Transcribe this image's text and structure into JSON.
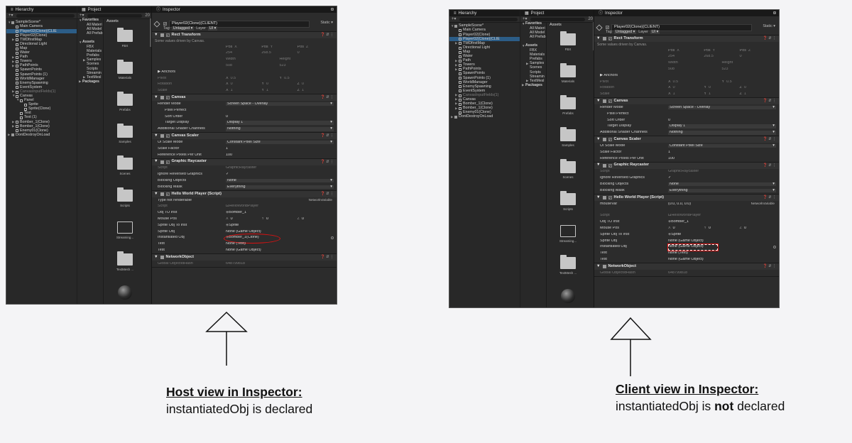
{
  "host": {
    "hierarchy": {
      "tab": "Hierarchy",
      "search": "All",
      "items": [
        {
          "label": "SampleScene*",
          "indent": 0,
          "arrow": "down",
          "kind": "scene"
        },
        {
          "label": "Main Camera",
          "indent": 1
        },
        {
          "label": "Player02(Clone)(CLIE",
          "indent": 1,
          "selected": true
        },
        {
          "label": "Player02(Clone)",
          "indent": 1
        },
        {
          "label": "TWDfirstMap",
          "indent": 1,
          "arrow": "right"
        },
        {
          "label": "Directional Light",
          "indent": 1
        },
        {
          "label": "Map",
          "indent": 1
        },
        {
          "label": "Water",
          "indent": 1
        },
        {
          "label": "Path",
          "indent": 1,
          "arrow": "right"
        },
        {
          "label": "Towers",
          "indent": 1,
          "arrow": "right"
        },
        {
          "label": "PathPoints",
          "indent": 1,
          "arrow": "right"
        },
        {
          "label": "SpawnPoints",
          "indent": 1
        },
        {
          "label": "SpawnPoints (1)",
          "indent": 1
        },
        {
          "label": "WorldManager",
          "indent": 1
        },
        {
          "label": "EnemySpawning",
          "indent": 1
        },
        {
          "label": "EventSystem",
          "indent": 1
        },
        {
          "label": "CanvasInputFields(1)",
          "indent": 1,
          "arrow": "right",
          "dim": true
        },
        {
          "label": "Canvas",
          "indent": 1,
          "arrow": "down"
        },
        {
          "label": "Panel",
          "indent": 2,
          "arrow": "down"
        },
        {
          "label": "Sprite",
          "indent": 3
        },
        {
          "label": "Sprite(Clone)",
          "indent": 3
        },
        {
          "label": "Text",
          "indent": 2
        },
        {
          "label": "Text (1)",
          "indent": 2
        },
        {
          "label": "Bomber_1(Clone)",
          "indent": 1,
          "arrow": "right"
        },
        {
          "label": "Bomber_1(Clone)",
          "indent": 1,
          "arrow": "right"
        },
        {
          "label": "Enemy01(Clone)",
          "indent": 1
        },
        {
          "label": "DontDestroyOnLoad",
          "indent": 0,
          "arrow": "right",
          "kind": "scene"
        }
      ]
    },
    "project": {
      "tab": "Project",
      "count": "20",
      "favorites": [
        {
          "label": "Favorites",
          "arrow": "down",
          "bold": true
        },
        {
          "label": "All Materi",
          "indent": 1
        },
        {
          "label": "All Model",
          "indent": 1
        },
        {
          "label": "All Prefab",
          "indent": 1
        },
        {
          "label": "",
          "spacer": true
        },
        {
          "label": "Assets",
          "arrow": "down",
          "bold": true
        },
        {
          "label": "FBX",
          "indent": 1
        },
        {
          "label": "Materials",
          "indent": 1
        },
        {
          "label": "Prefabs",
          "indent": 1
        },
        {
          "label": "Samples",
          "indent": 1,
          "arrow": "right"
        },
        {
          "label": "Scenes",
          "indent": 1
        },
        {
          "label": "Scripts",
          "indent": 1
        },
        {
          "label": "Streamin",
          "indent": 1
        },
        {
          "label": "TextMesl",
          "indent": 1,
          "arrow": "right"
        },
        {
          "label": "Packages",
          "arrow": "right",
          "bold": true
        }
      ],
      "assets_label": "Assets",
      "grid": [
        {
          "label": "FBX",
          "kind": "folder"
        },
        {
          "label": "Materials",
          "kind": "folder"
        },
        {
          "label": "Prefabs",
          "kind": "folder"
        },
        {
          "label": "Samples",
          "kind": "folder"
        },
        {
          "label": "Scenes",
          "kind": "folder"
        },
        {
          "label": "Scripts",
          "kind": "folder"
        },
        {
          "label": "Streaming...",
          "kind": "open"
        },
        {
          "label": "TextMesh ...",
          "kind": "folder"
        },
        {
          "label": "",
          "kind": "sphere"
        }
      ]
    },
    "inspector": {
      "tab": "Inspector",
      "object_name": "Player02(Clone)(CLIENT)",
      "static": "Static",
      "tag_label": "Tag",
      "tag": "Untagged",
      "layer_label": "Layer",
      "layer": "UI",
      "rect": {
        "title": "Rect Transform",
        "note": "Some values driven by Canvas.",
        "pos_labels": [
          "Pos X",
          "Pos Y",
          "Pos Z"
        ],
        "pos_values": [
          "254",
          "268.5",
          "0"
        ],
        "size_labels": [
          "Width",
          "Height"
        ],
        "size_values": [
          "508",
          "523"
        ],
        "anchors": "Anchors",
        "pivot_label": "Pivot",
        "pivot": [
          "X 0.5",
          "Y 0.5"
        ],
        "rotation_label": "Rotation",
        "rotation": [
          "X 0",
          "Y 0",
          "Z 0"
        ],
        "scale_label": "Scale",
        "scale": [
          "X 1",
          "Y 1",
          "Z 1"
        ]
      },
      "canvas": {
        "title": "Canvas",
        "rows": [
          [
            "Render Mode",
            "Screen Space - Overlay"
          ],
          [
            "Pixel Perfect",
            ""
          ],
          [
            "Sort Order",
            "0"
          ],
          [
            "Target Display",
            "Display 1"
          ],
          [
            "Additional Shader Channels",
            "Nothing"
          ]
        ]
      },
      "scaler": {
        "title": "Canvas Scaler",
        "rows": [
          [
            "UI Scale Mode",
            "Constant Pixel Size"
          ],
          [
            "Scale Factor",
            "1"
          ],
          [
            "Reference Pixels Per Unit",
            "100"
          ]
        ]
      },
      "raycaster": {
        "title": "Graphic Raycaster",
        "rows": [
          [
            "Script",
            "GraphicRaycaster"
          ],
          [
            "Ignore Reversed Graphics",
            "✓"
          ],
          [
            "Blocking Objects",
            "None"
          ],
          [
            "Blocking Mask",
            "Everything"
          ]
        ]
      },
      "hello": {
        "title": "Hello World Player (Script)",
        "extra_label": "Type not renderable",
        "extra_value": "NetworkVariable",
        "script_label": "Script",
        "script": "HelloWorldPlayer",
        "obj_to_inst_label": "Obj TO Inst",
        "obj_to_inst": "Bomber_1",
        "mouse_label": "Mouse Pos",
        "mouse": [
          "X 0",
          "Y 0",
          "Z 0"
        ],
        "sprite_to_inst_label": "Sprite Obj To Inst",
        "sprite_to_inst": "Sprite",
        "sprite_obj_label": "Sprite Obj",
        "sprite_obj": "None (Game Object)",
        "inst_label": "Instantiated Obj",
        "inst": "Bomber_1(Clone)",
        "text_label": "Text",
        "text": "None (Text)",
        "test_label": "Test",
        "test": "None (Game Object)"
      },
      "network": {
        "title": "NetworkObject",
        "row_label": "Global ObjectIdHash",
        "row_value": "648799818"
      }
    }
  },
  "client": {
    "hierarchy": {
      "items": [
        {
          "label": "SampleScene*",
          "indent": 0,
          "arrow": "down",
          "kind": "scene"
        },
        {
          "label": "Main Camera",
          "indent": 1
        },
        {
          "label": "Player02(Clone)",
          "indent": 1
        },
        {
          "label": "Player02(Clone)(CLIE",
          "indent": 1,
          "selected": true
        },
        {
          "label": "TWDfirstMap",
          "indent": 1,
          "arrow": "right"
        },
        {
          "label": "Directional Light",
          "indent": 1
        },
        {
          "label": "Map",
          "indent": 1
        },
        {
          "label": "Water",
          "indent": 1
        },
        {
          "label": "Path",
          "indent": 1,
          "arrow": "right"
        },
        {
          "label": "Towers",
          "indent": 1,
          "arrow": "right"
        },
        {
          "label": "PathPoints",
          "indent": 1,
          "arrow": "right"
        },
        {
          "label": "SpawnPoints",
          "indent": 1
        },
        {
          "label": "SpawnPoints (1)",
          "indent": 1
        },
        {
          "label": "WorldManager",
          "indent": 1
        },
        {
          "label": "EnemySpawning",
          "indent": 1
        },
        {
          "label": "EventSystem",
          "indent": 1
        },
        {
          "label": "CanvasInputFields(1)",
          "indent": 1,
          "arrow": "right",
          "dim": true
        },
        {
          "label": "Canvas",
          "indent": 1,
          "arrow": "right"
        },
        {
          "label": "Bomber_1(Clone)",
          "indent": 1,
          "arrow": "right"
        },
        {
          "label": "Bomber_1(Clone)",
          "indent": 1,
          "arrow": "right"
        },
        {
          "label": "Enemy01(Clone)",
          "indent": 1
        },
        {
          "label": "DontDestroyOnLoad",
          "indent": 0,
          "arrow": "right",
          "kind": "scene"
        }
      ]
    },
    "inspector": {
      "mouse_var_label": "mouseVar",
      "mouse_var": "(0.0, 0.0, 0.0)",
      "inst": "None (Game Object)"
    }
  },
  "captions": {
    "host_title": "Host view in Inspector:",
    "host_body": "instantiatedObj is declared",
    "client_title": "Client view in Inspector:",
    "client_body_pre": "instantiatedObj is ",
    "client_body_bold": "not",
    "client_body_post": " declared"
  }
}
